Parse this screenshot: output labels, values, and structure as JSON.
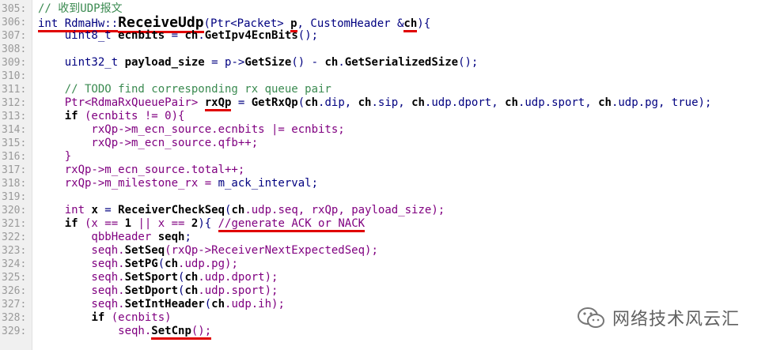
{
  "lines": [
    {
      "num": "305:",
      "segs": [
        {
          "t": "// 收到UDP报文",
          "c": "c"
        }
      ]
    },
    {
      "num": "306:",
      "segs": [
        {
          "t": "int ",
          "c": "k u"
        },
        {
          "t": "RdmaHw::",
          "c": "k u"
        },
        {
          "t": "ReceiveUdp",
          "c": "hl u"
        },
        {
          "t": "(Ptr<Packet> ",
          "c": "k"
        },
        {
          "t": "p",
          "c": "b u"
        },
        {
          "t": ", CustomHeader &",
          "c": "k"
        },
        {
          "t": "ch",
          "c": "b u"
        },
        {
          "t": "){",
          "c": "k"
        }
      ]
    },
    {
      "num": "307:",
      "segs": [
        {
          "t": "    uint8_t ",
          "c": "k"
        },
        {
          "t": "ecnbits",
          "c": "b"
        },
        {
          "t": " = ",
          "c": "k"
        },
        {
          "t": "ch",
          "c": "b"
        },
        {
          "t": ".",
          "c": "k"
        },
        {
          "t": "GetIpv4EcnBits",
          "c": "b"
        },
        {
          "t": "();",
          "c": "k"
        }
      ]
    },
    {
      "num": "308:",
      "segs": []
    },
    {
      "num": "309:",
      "segs": [
        {
          "t": "    uint32_t ",
          "c": "k"
        },
        {
          "t": "payload_size",
          "c": "b"
        },
        {
          "t": " = p->",
          "c": "k"
        },
        {
          "t": "GetSize",
          "c": "b"
        },
        {
          "t": "() - ",
          "c": "k"
        },
        {
          "t": "ch",
          "c": "b"
        },
        {
          "t": ".",
          "c": "k"
        },
        {
          "t": "GetSerializedSize",
          "c": "b"
        },
        {
          "t": "();",
          "c": "k"
        }
      ]
    },
    {
      "num": "310:",
      "segs": []
    },
    {
      "num": "311:",
      "segs": [
        {
          "t": "    // TODO find corresponding rx queue pair",
          "c": "c"
        }
      ]
    },
    {
      "num": "312:",
      "segs": [
        {
          "t": "    Ptr<RdmaRxQueuePair> ",
          "c": "n"
        },
        {
          "t": "rxQp",
          "c": "b u"
        },
        {
          "t": " = ",
          "c": "k"
        },
        {
          "t": "GetRxQp",
          "c": "b"
        },
        {
          "t": "(",
          "c": "k"
        },
        {
          "t": "ch",
          "c": "b"
        },
        {
          "t": ".dip, ",
          "c": "k"
        },
        {
          "t": "ch",
          "c": "b"
        },
        {
          "t": ".sip, ",
          "c": "k"
        },
        {
          "t": "ch",
          "c": "b"
        },
        {
          "t": ".udp.dport, ",
          "c": "k"
        },
        {
          "t": "ch",
          "c": "b"
        },
        {
          "t": ".udp.sport, ",
          "c": "k"
        },
        {
          "t": "ch",
          "c": "b"
        },
        {
          "t": ".udp.pg, true);",
          "c": "k"
        }
      ]
    },
    {
      "num": "313:",
      "segs": [
        {
          "t": "    ",
          "c": "k"
        },
        {
          "t": "if",
          "c": "b"
        },
        {
          "t": " (ecnbits != 0){",
          "c": "n"
        }
      ]
    },
    {
      "num": "314:",
      "segs": [
        {
          "t": "        rxQp->m_ecn_source.ecnbits |= ecnbits;",
          "c": "n"
        }
      ]
    },
    {
      "num": "315:",
      "segs": [
        {
          "t": "        rxQp->m_ecn_source.qfb++;",
          "c": "n"
        }
      ]
    },
    {
      "num": "316:",
      "segs": [
        {
          "t": "    }",
          "c": "n"
        }
      ]
    },
    {
      "num": "317:",
      "segs": [
        {
          "t": "    rxQp->m_ecn_source.total++;",
          "c": "n"
        }
      ]
    },
    {
      "num": "318:",
      "segs": [
        {
          "t": "    rxQp->m_milestone_rx = ",
          "c": "n"
        },
        {
          "t": "m_ack_interval;",
          "c": "k"
        }
      ]
    },
    {
      "num": "319:",
      "segs": []
    },
    {
      "num": "320:",
      "segs": [
        {
          "t": "    int ",
          "c": "n"
        },
        {
          "t": "x",
          "c": "b"
        },
        {
          "t": " = ",
          "c": "k"
        },
        {
          "t": "ReceiverCheckSeq",
          "c": "b"
        },
        {
          "t": "(",
          "c": "k"
        },
        {
          "t": "ch",
          "c": "b"
        },
        {
          "t": ".udp.seq, rxQp, payload_size);",
          "c": "n"
        }
      ]
    },
    {
      "num": "321:",
      "segs": [
        {
          "t": "    ",
          "c": "k"
        },
        {
          "t": "if",
          "c": "b"
        },
        {
          "t": " (x == ",
          "c": "n"
        },
        {
          "t": "1",
          "c": "b"
        },
        {
          "t": " || x == ",
          "c": "n"
        },
        {
          "t": "2",
          "c": "b"
        },
        {
          "t": "){ ",
          "c": "k"
        },
        {
          "t": "//generate ACK or NACK",
          "c": "n u"
        }
      ]
    },
    {
      "num": "322:",
      "segs": [
        {
          "t": "        qbbHeader ",
          "c": "n"
        },
        {
          "t": "seqh",
          "c": "b"
        },
        {
          "t": ";",
          "c": "k"
        }
      ]
    },
    {
      "num": "323:",
      "segs": [
        {
          "t": "        seqh.",
          "c": "n"
        },
        {
          "t": "SetSeq",
          "c": "b"
        },
        {
          "t": "(rxQp->ReceiverNextExpectedSeq);",
          "c": "n"
        }
      ]
    },
    {
      "num": "324:",
      "segs": [
        {
          "t": "        seqh.",
          "c": "n"
        },
        {
          "t": "SetPG",
          "c": "b"
        },
        {
          "t": "(",
          "c": "k"
        },
        {
          "t": "ch",
          "c": "b"
        },
        {
          "t": ".udp.pg);",
          "c": "n"
        }
      ]
    },
    {
      "num": "325:",
      "segs": [
        {
          "t": "        seqh.",
          "c": "n"
        },
        {
          "t": "SetSport",
          "c": "b"
        },
        {
          "t": "(",
          "c": "k"
        },
        {
          "t": "ch",
          "c": "b"
        },
        {
          "t": ".udp.dport);",
          "c": "n"
        }
      ]
    },
    {
      "num": "326:",
      "segs": [
        {
          "t": "        seqh.",
          "c": "n"
        },
        {
          "t": "SetDport",
          "c": "b"
        },
        {
          "t": "(",
          "c": "k"
        },
        {
          "t": "ch",
          "c": "b"
        },
        {
          "t": ".udp.sport);",
          "c": "n"
        }
      ]
    },
    {
      "num": "327:",
      "segs": [
        {
          "t": "        seqh.",
          "c": "n"
        },
        {
          "t": "SetIntHeader",
          "c": "b"
        },
        {
          "t": "(",
          "c": "k"
        },
        {
          "t": "ch",
          "c": "b"
        },
        {
          "t": ".udp.ih);",
          "c": "n"
        }
      ]
    },
    {
      "num": "328:",
      "segs": [
        {
          "t": "        ",
          "c": "k"
        },
        {
          "t": "if",
          "c": "b"
        },
        {
          "t": " (ecnbits)",
          "c": "n"
        }
      ]
    },
    {
      "num": "329:",
      "segs": [
        {
          "t": "            seqh.",
          "c": "n"
        },
        {
          "t": "SetCnp",
          "c": "b u"
        },
        {
          "t": "();",
          "c": "n u"
        }
      ]
    }
  ],
  "watermark": {
    "text": "网络技术风云汇",
    "icon": "wechat-icon"
  }
}
